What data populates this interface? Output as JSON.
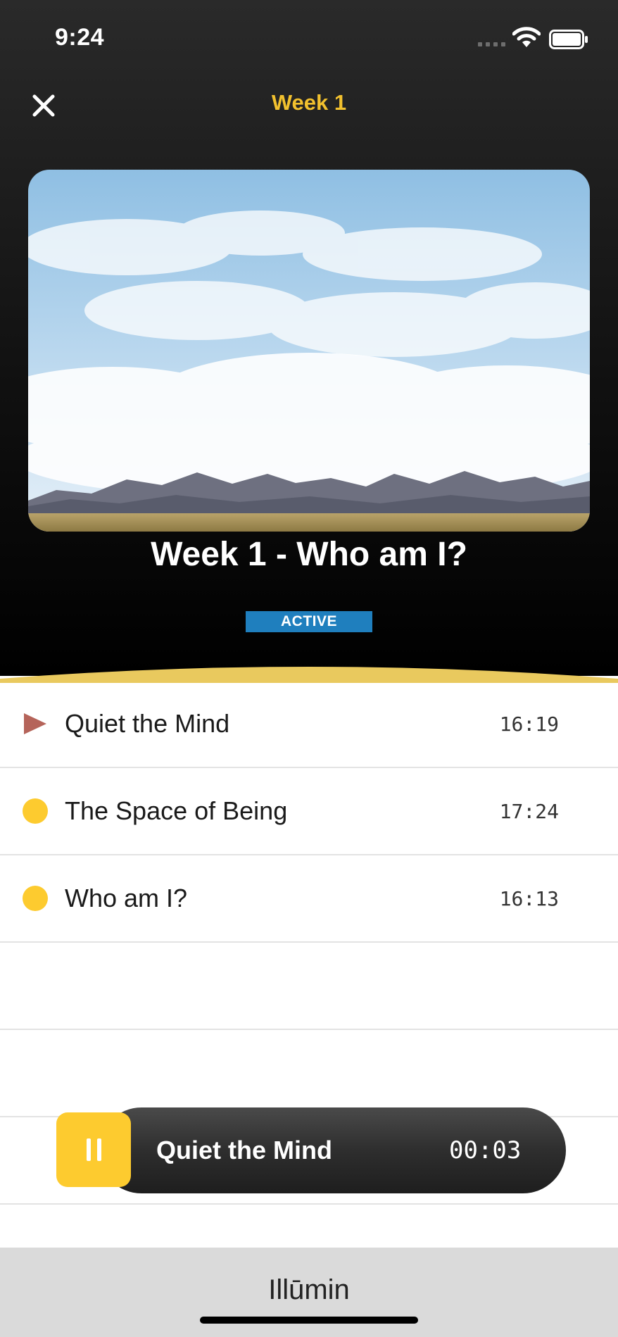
{
  "status_bar": {
    "time": "9:24"
  },
  "nav": {
    "title": "Week 1"
  },
  "week": {
    "heading": "Week 1 - Who am I?",
    "status": "ACTIVE"
  },
  "tracks": [
    {
      "title": "Quiet the Mind",
      "duration": "16:19",
      "state": "playing"
    },
    {
      "title": "The Space of Being",
      "duration": "17:24",
      "state": "unplayed"
    },
    {
      "title": "Who am I?",
      "duration": "16:13",
      "state": "unplayed"
    }
  ],
  "player": {
    "title": "Quiet the Mind",
    "elapsed": "00:03"
  },
  "footer": {
    "brand": "Illūmin"
  },
  "colors": {
    "accent_yellow": "#FDCB2F",
    "title_yellow": "#F2C12E",
    "badge_blue": "#1F7FBE",
    "play_triangle": "#B5645A"
  }
}
